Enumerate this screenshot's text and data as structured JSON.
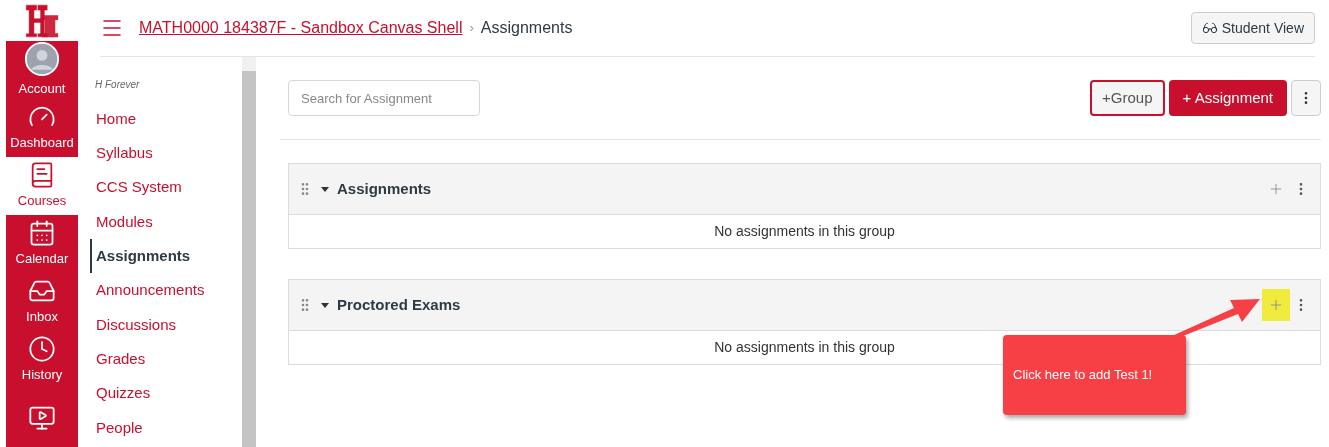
{
  "global_nav": [
    {
      "kind": "avatar",
      "label": "Account",
      "selected": false
    },
    {
      "kind": "dashboard",
      "label": "Dashboard",
      "selected": false
    },
    {
      "kind": "courses",
      "label": "Courses",
      "selected": true
    },
    {
      "kind": "calendar",
      "label": "Calendar",
      "selected": false
    },
    {
      "kind": "inbox",
      "label": "Inbox",
      "selected": false
    },
    {
      "kind": "history",
      "label": "History",
      "selected": false
    },
    {
      "kind": "media",
      "selected": false
    }
  ],
  "breadcrumb": {
    "course": "MATH0000 184387F - Sandbox Canvas Shell",
    "separator": "›",
    "current": "Assignments"
  },
  "student_view_button": "Student View",
  "course_nav": {
    "term": "H Forever",
    "items": [
      {
        "label": "Home",
        "selected": false
      },
      {
        "label": "Syllabus",
        "selected": false
      },
      {
        "label": "CCS System",
        "selected": false
      },
      {
        "label": "Modules",
        "selected": false
      },
      {
        "label": "Assignments",
        "selected": true
      },
      {
        "label": "Announcements",
        "selected": false
      },
      {
        "label": "Discussions",
        "selected": false
      },
      {
        "label": "Grades",
        "selected": false
      },
      {
        "label": "Quizzes",
        "selected": false
      },
      {
        "label": "People",
        "selected": false
      }
    ]
  },
  "search": {
    "placeholder": "Search for Assignment"
  },
  "toolbar": {
    "group_button": "+Group",
    "assignment_button": "+ Assignment"
  },
  "groups": [
    {
      "title": "Assignments",
      "expanded": true,
      "add_highlighted": false,
      "empty_text": "No assignments in this group"
    },
    {
      "title": "Proctored Exams",
      "expanded": true,
      "add_highlighted": true,
      "empty_text": "No assignments in this group"
    }
  ],
  "callout": {
    "text": "Click here to add Test 1!"
  }
}
